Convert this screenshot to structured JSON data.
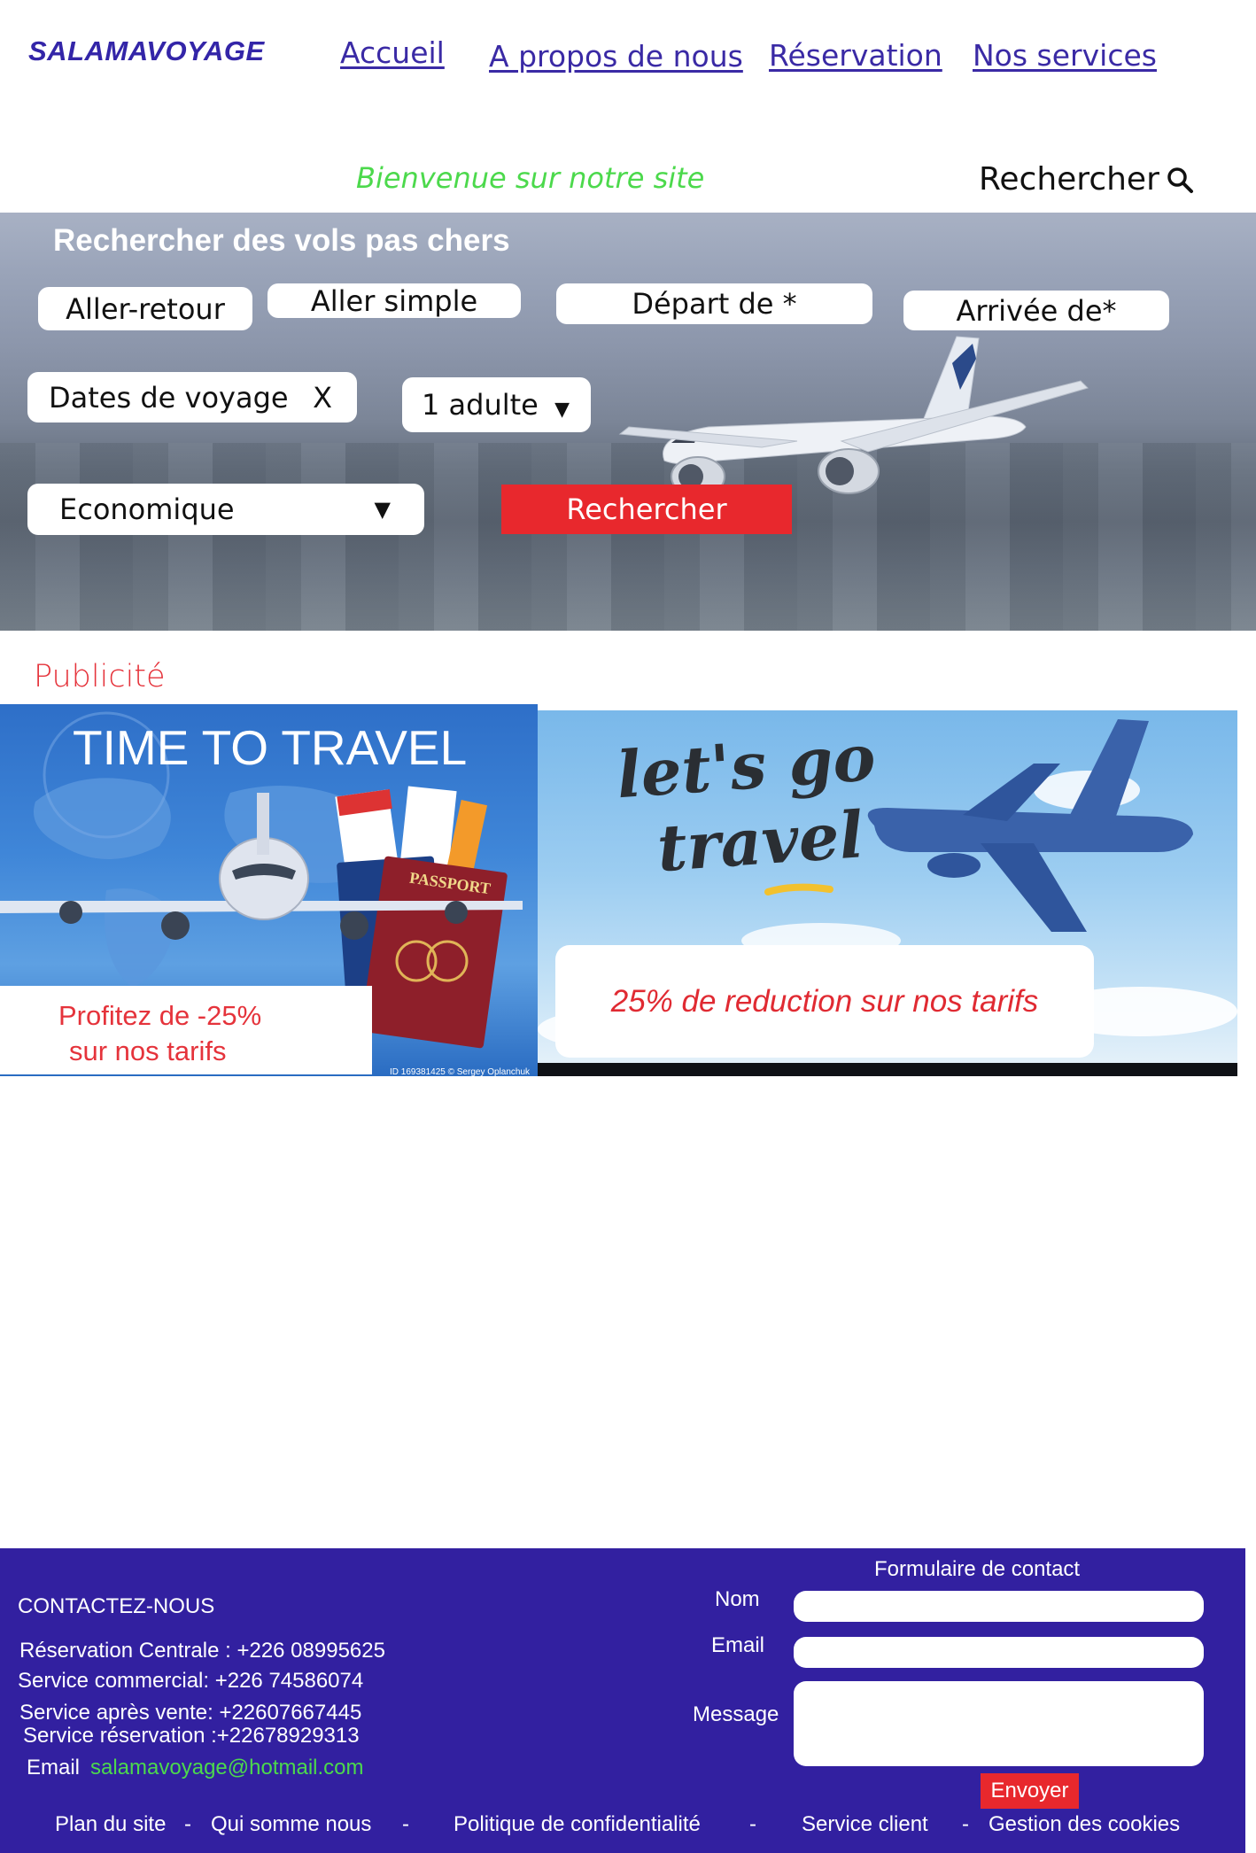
{
  "header": {
    "logo": "SALAMAVOYAGE",
    "nav": [
      "Accueil",
      "A propos de nous",
      "Réservation",
      "Nos services"
    ],
    "welcome": "Bienvenue sur notre site",
    "search_label": "Rechercher"
  },
  "search_form": {
    "title": "Rechercher des vols pas chers",
    "trip_round": "Aller-retour",
    "trip_oneway": "Aller simple",
    "departure": "Départ de *",
    "arrival": "Arrivée de*",
    "dates": "Dates de voyage",
    "dates_clear": "X",
    "passengers": "1 adulte",
    "cabin": "Economique",
    "submit": "Rechercher"
  },
  "ads": {
    "heading": "Publicité",
    "ad1": {
      "headline": "TIME TO TRAVEL",
      "caption_line1": "Profitez de -25%",
      "caption_line2": "sur nos tarifs",
      "passport_label": "PASSPORT",
      "credit": "ID 169381425 © Sergey Oplanchuk"
    },
    "ad2": {
      "script_line1": "let's go",
      "script_line2": "travel",
      "caption": "25% de reduction sur nos tarifs"
    }
  },
  "footer": {
    "contact_heading": "CONTACTEZ-NOUS",
    "lines": [
      "Réservation Centrale : +226 08995625",
      "Service commercial: +226 74586074",
      "Service après vente: +22607667445",
      "Service réservation :+22678929313"
    ],
    "email_label": "Email",
    "email_value": "salamavoyage@hotmail.com",
    "form_title": "Formulaire de contact",
    "name_label": "Nom",
    "email_field_label": "Email",
    "message_label": "Message",
    "send": "Envoyer",
    "links": [
      "Plan du site",
      "Qui somme nous",
      "Politique de confidentialité",
      "Service client",
      "Gestion des cookies"
    ],
    "separator": "-"
  },
  "colors": {
    "brand": "#3325a8",
    "accent_red": "#e8282d",
    "welcome_green": "#4cd94c",
    "footer_bg": "#3220a0"
  }
}
